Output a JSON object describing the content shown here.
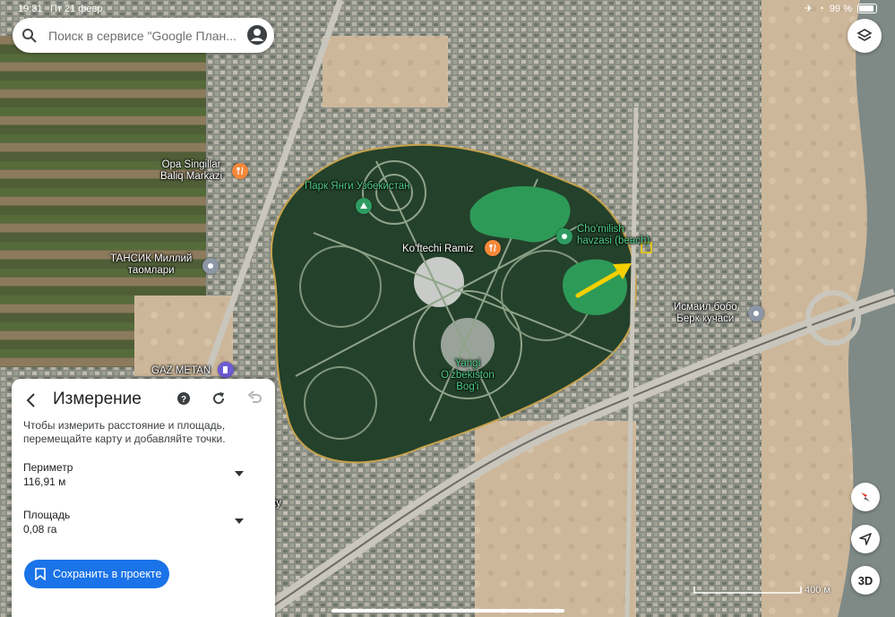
{
  "status_bar": {
    "time": "19:31",
    "date": "Пт 21 февр.",
    "battery": "99 %"
  },
  "search": {
    "placeholder": "Поиск в сервисе \"Google План..."
  },
  "map": {
    "labels": [
      {
        "name": "opa-singillar-label",
        "text": "Opa Singillar\nBaliq Markazi",
        "style": "white"
      },
      {
        "name": "park-yangi-label",
        "text": "Парк Янги Узбекистан",
        "style": "green"
      },
      {
        "name": "koftechi-label",
        "text": "Ko'ftechi Ramiz",
        "style": "white"
      },
      {
        "name": "chomilish-label",
        "text": "Cho'milish\nhavzasi (beach)",
        "style": "green"
      },
      {
        "name": "tansik-label",
        "text": "ТАНСИК Миллий\nтаомлари",
        "style": "white"
      },
      {
        "name": "ismail-bobo-label",
        "text": "Исмаил бобо\nБерк кучаси",
        "style": "white"
      },
      {
        "name": "gaz-metan-label",
        "text": "GAZ METAN",
        "style": "white"
      },
      {
        "name": "yangi-uzbekiston-label",
        "text": "Yangi\nO'zbekiston\nBog'i",
        "style": "green"
      },
      {
        "name": "partial-city-label",
        "text": "ty",
        "style": "white"
      }
    ],
    "scale_label": "400 м",
    "accent_color": "#f5d000"
  },
  "controls": {
    "three_d_label": "3D"
  },
  "measure_panel": {
    "title": "Измерение",
    "hint": "Чтобы измерить расстояние и площадь, перемещайте карту и добавляйте точки.",
    "perimeter_label": "Периметр",
    "perimeter_value": "116,91 м",
    "area_label": "Площадь",
    "area_value": "0,08 га",
    "save_label": "Сохранить в проекте"
  }
}
